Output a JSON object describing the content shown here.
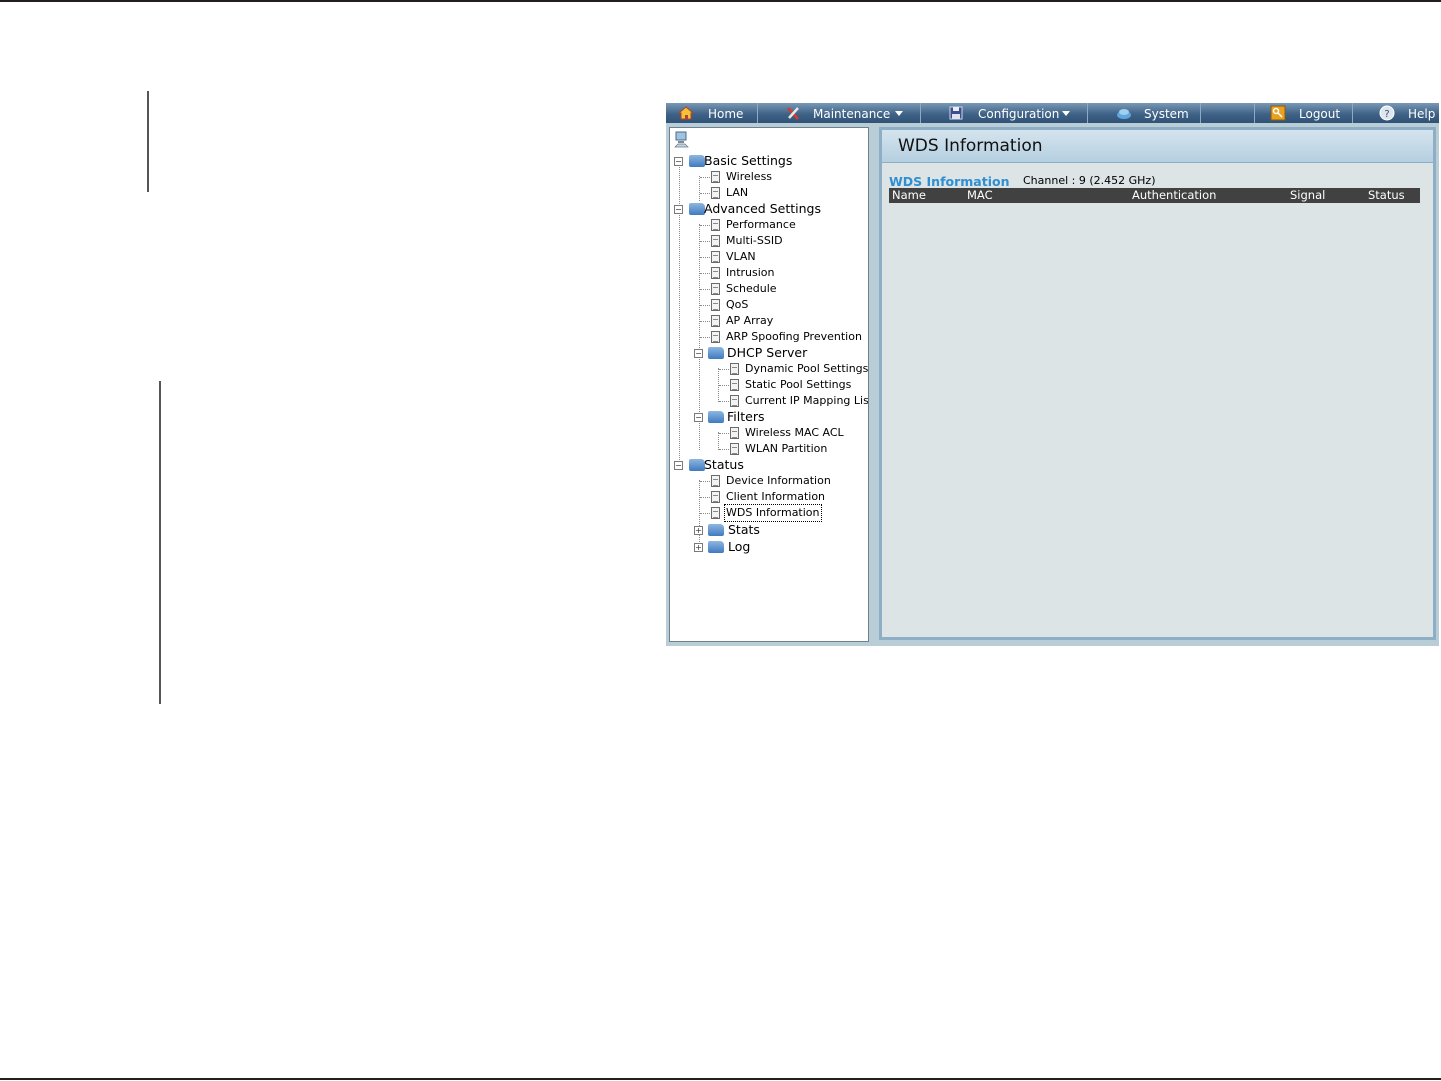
{
  "menubar": {
    "items": [
      {
        "label": "Home",
        "icon": "home-icon",
        "dropdown": false
      },
      {
        "label": "Maintenance",
        "icon": "tools-icon",
        "dropdown": true
      },
      {
        "label": "Configuration",
        "icon": "floppy-disk-icon",
        "dropdown": true
      },
      {
        "label": "System",
        "icon": "system-icon",
        "dropdown": false
      },
      {
        "label": "Logout",
        "icon": "key-icon",
        "dropdown": false
      },
      {
        "label": "Help",
        "icon": "help-icon",
        "dropdown": false
      }
    ]
  },
  "tree": {
    "basic_settings": {
      "label": "Basic Settings",
      "children": [
        "Wireless",
        "LAN"
      ]
    },
    "advanced_settings": {
      "label": "Advanced Settings",
      "children": [
        "Performance",
        "Multi-SSID",
        "VLAN",
        "Intrusion",
        "Schedule",
        "QoS",
        "AP Array",
        "ARP Spoofing Prevention"
      ],
      "dhcp_server": {
        "label": "DHCP Server",
        "children": [
          "Dynamic Pool Settings",
          "Static Pool Settings",
          "Current IP Mapping List"
        ]
      },
      "filters": {
        "label": "Filters",
        "children": [
          "Wireless MAC ACL",
          "WLAN Partition"
        ]
      }
    },
    "status": {
      "label": "Status",
      "children": [
        "Device Information",
        "Client Information",
        "WDS Information"
      ],
      "selected": "WDS Information",
      "stats": "Stats",
      "log": "Log"
    }
  },
  "content": {
    "title": "WDS Information",
    "section_label": "WDS Information",
    "channel": "Channel : 9 (2.452 GHz)",
    "table_headers": [
      "Name",
      "MAC",
      "Authentication",
      "Signal",
      "Status"
    ]
  }
}
